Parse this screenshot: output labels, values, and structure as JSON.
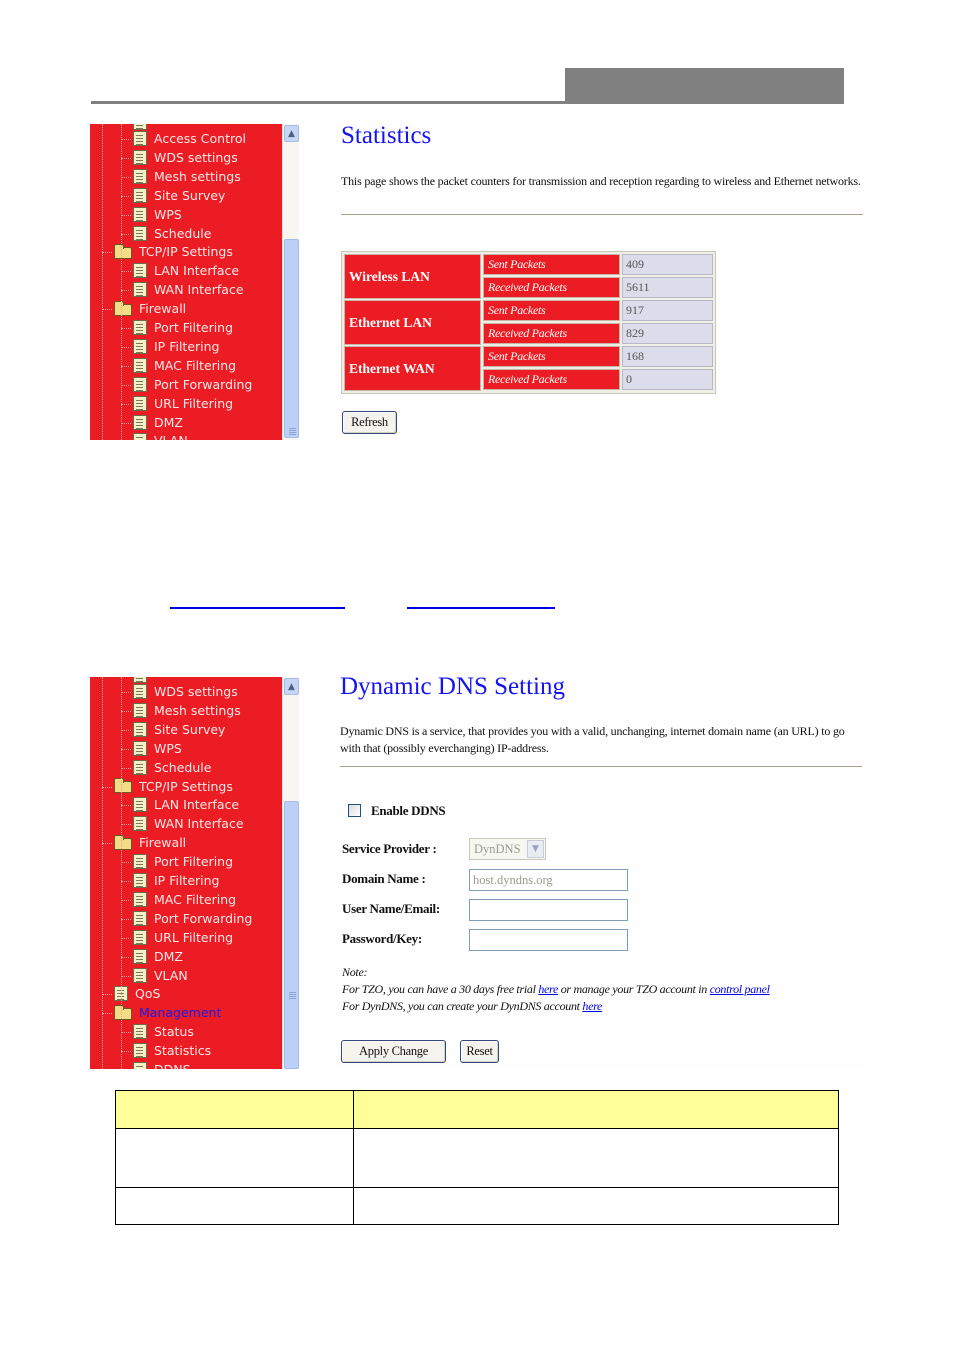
{
  "doc": {
    "header_bar_color": "#808080",
    "link_underline_color": "#0000e6",
    "table_header_color": "#ffff99",
    "bottom_table": {
      "columns": 2,
      "rows": [
        [
          "",
          ""
        ],
        [
          "",
          ""
        ],
        [
          "",
          ""
        ]
      ]
    }
  },
  "colors": {
    "sidebar": "#ec1c24",
    "title": "#1414f0",
    "value_cell": "#dcdcea"
  },
  "statistics_screen": {
    "sidebar": [
      {
        "label": "Access Control",
        "type": "page",
        "level": 2
      },
      {
        "label": "WDS settings",
        "type": "page",
        "level": 2
      },
      {
        "label": "Mesh settings",
        "type": "page",
        "level": 2
      },
      {
        "label": "Site Survey",
        "type": "page",
        "level": 2
      },
      {
        "label": "WPS",
        "type": "page",
        "level": 2
      },
      {
        "label": "Schedule",
        "type": "page",
        "level": 2
      },
      {
        "label": "TCP/IP Settings",
        "type": "folder",
        "level": 1
      },
      {
        "label": "LAN Interface",
        "type": "page",
        "level": 2
      },
      {
        "label": "WAN Interface",
        "type": "page",
        "level": 2
      },
      {
        "label": "Firewall",
        "type": "folder",
        "level": 1
      },
      {
        "label": "Port Filtering",
        "type": "page",
        "level": 2
      },
      {
        "label": "IP Filtering",
        "type": "page",
        "level": 2
      },
      {
        "label": "MAC Filtering",
        "type": "page",
        "level": 2
      },
      {
        "label": "Port Forwarding",
        "type": "page",
        "level": 2
      },
      {
        "label": "URL Filtering",
        "type": "page",
        "level": 2
      },
      {
        "label": "DMZ",
        "type": "page",
        "level": 2
      },
      {
        "label": "VLAN",
        "type": "page",
        "level": 2
      }
    ],
    "title": "Statistics",
    "description": "This page shows the packet counters for transmission and reception regarding to wireless and Ethernet networks.",
    "table": [
      {
        "group": "Wireless LAN",
        "rows": [
          {
            "label": "Sent Packets",
            "value": "409"
          },
          {
            "label": "Received Packets",
            "value": "5611"
          }
        ]
      },
      {
        "group": "Ethernet LAN",
        "rows": [
          {
            "label": "Sent Packets",
            "value": "917"
          },
          {
            "label": "Received Packets",
            "value": "829"
          }
        ]
      },
      {
        "group": "Ethernet WAN",
        "rows": [
          {
            "label": "Sent Packets",
            "value": "168"
          },
          {
            "label": "Received Packets",
            "value": "0"
          }
        ]
      }
    ],
    "refresh_label": "Refresh"
  },
  "ddns_screen": {
    "sidebar": [
      {
        "label": "WDS settings",
        "type": "page",
        "level": 2
      },
      {
        "label": "Mesh settings",
        "type": "page",
        "level": 2
      },
      {
        "label": "Site Survey",
        "type": "page",
        "level": 2
      },
      {
        "label": "WPS",
        "type": "page",
        "level": 2
      },
      {
        "label": "Schedule",
        "type": "page",
        "level": 2
      },
      {
        "label": "TCP/IP Settings",
        "type": "folder",
        "level": 1
      },
      {
        "label": "LAN Interface",
        "type": "page",
        "level": 2
      },
      {
        "label": "WAN Interface",
        "type": "page",
        "level": 2
      },
      {
        "label": "Firewall",
        "type": "folder",
        "level": 1
      },
      {
        "label": "Port Filtering",
        "type": "page",
        "level": 2
      },
      {
        "label": "IP Filtering",
        "type": "page",
        "level": 2
      },
      {
        "label": "MAC Filtering",
        "type": "page",
        "level": 2
      },
      {
        "label": "Port Forwarding",
        "type": "page",
        "level": 2
      },
      {
        "label": "URL Filtering",
        "type": "page",
        "level": 2
      },
      {
        "label": "DMZ",
        "type": "page",
        "level": 2
      },
      {
        "label": "VLAN",
        "type": "page",
        "level": 2
      },
      {
        "label": "QoS",
        "type": "page",
        "level": 1
      },
      {
        "label": "Management",
        "type": "folder",
        "level": 1,
        "active": true
      },
      {
        "label": "Status",
        "type": "page",
        "level": 2
      },
      {
        "label": "Statistics",
        "type": "page",
        "level": 2
      },
      {
        "label": "DDNS",
        "type": "page",
        "level": 2
      }
    ],
    "title": "Dynamic DNS  Setting",
    "description": "Dynamic DNS is a service, that provides you with a valid, unchanging, internet domain name (an URL) to go with that (possibly everchanging) IP-address.",
    "enable_label": "Enable DDNS",
    "enable_checked": false,
    "service_provider_label": "Service Provider :",
    "service_provider_value": "DynDNS",
    "domain_name_label": "Domain Name :",
    "domain_name_value": "host.dyndns.org",
    "username_label": "User Name/Email:",
    "username_value": "",
    "password_label": "Password/Key:",
    "password_value": "",
    "note_title": "Note:",
    "note_line1_prefix": "For TZO, you can have a 30 days free trial ",
    "note_line1_link1": "here",
    "note_line1_mid": " or manage your TZO account in ",
    "note_line1_link2": "control panel",
    "note_line2_prefix": "For DynDNS, you can create your DynDNS account ",
    "note_line2_link": "here",
    "apply_label": "Apply Change",
    "reset_label": "Reset"
  }
}
